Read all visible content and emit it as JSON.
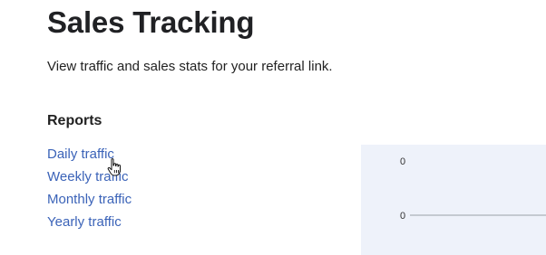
{
  "page": {
    "title": "Sales Tracking",
    "description": "View traffic and sales stats for your referral link."
  },
  "reports": {
    "heading": "Reports",
    "links": [
      {
        "label": "Daily traffic"
      },
      {
        "label": "Weekly traffic"
      },
      {
        "label": "Monthly traffic"
      },
      {
        "label": "Yearly traffic"
      }
    ]
  },
  "chart": {
    "background": "#eef2fa",
    "line_color": "#9aa3a8"
  },
  "chart_data": {
    "type": "line",
    "title": "",
    "xlabel": "",
    "ylabel": "",
    "y_tick_labels": [
      "0",
      "0"
    ],
    "series": [
      {
        "values": [
          0,
          0
        ]
      }
    ],
    "grid": false
  },
  "colors": {
    "link": "#3b63b8",
    "title": "#202124"
  },
  "cursor": {
    "icon": "hand-pointer-icon"
  }
}
